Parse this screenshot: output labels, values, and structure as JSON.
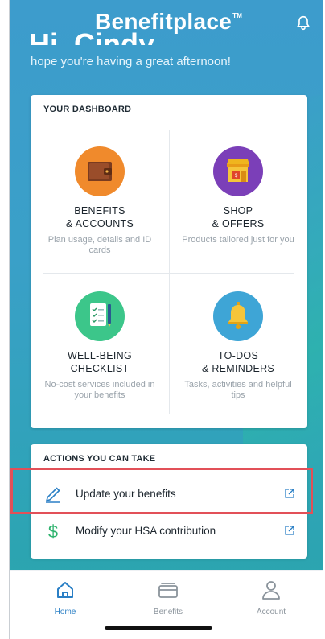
{
  "header": {
    "logo_text": "Benefitplace",
    "logo_tm": "TM",
    "bell_icon": "bell-icon"
  },
  "greeting": {
    "title": "Hi, Cindy",
    "subtitle": "hope you're having a great afternoon!"
  },
  "dashboard": {
    "title": "YOUR DASHBOARD",
    "tiles": [
      {
        "title_line1": "BENEFITS",
        "title_line2": "& ACCOUNTS",
        "desc": "Plan usage, details and ID cards",
        "icon": "wallet-icon",
        "color": "#f08a2c"
      },
      {
        "title_line1": "SHOP",
        "title_line2": "& OFFERS",
        "desc": "Products tailored just for you",
        "icon": "store-icon",
        "color": "#7b3fb8"
      },
      {
        "title_line1": "WELL-BEING",
        "title_line2": "CHECKLIST",
        "desc": "No-cost services included in your benefits",
        "icon": "checklist-icon",
        "color": "#3cc68a"
      },
      {
        "title_line1": "TO-DOS",
        "title_line2": "& REMINDERS",
        "desc": "Tasks, activities and helpful tips",
        "icon": "bell-icon",
        "color": "#3ea5d6"
      }
    ]
  },
  "actions": {
    "title": "ACTIONS YOU CAN TAKE",
    "items": [
      {
        "label": "Update your benefits",
        "icon": "pencil-icon"
      },
      {
        "label": "Modify your HSA contribution",
        "icon": "dollar-icon"
      }
    ]
  },
  "tabs": [
    {
      "label": "Home",
      "icon": "home-icon",
      "active": true
    },
    {
      "label": "Benefits",
      "icon": "cards-icon",
      "active": false
    },
    {
      "label": "Account",
      "icon": "person-icon",
      "active": false
    }
  ],
  "colors": {
    "accent": "#2a7fc5",
    "highlight_border": "#e25058",
    "background_top": "#3d9ccc",
    "background_bottom": "#29a6a9"
  }
}
